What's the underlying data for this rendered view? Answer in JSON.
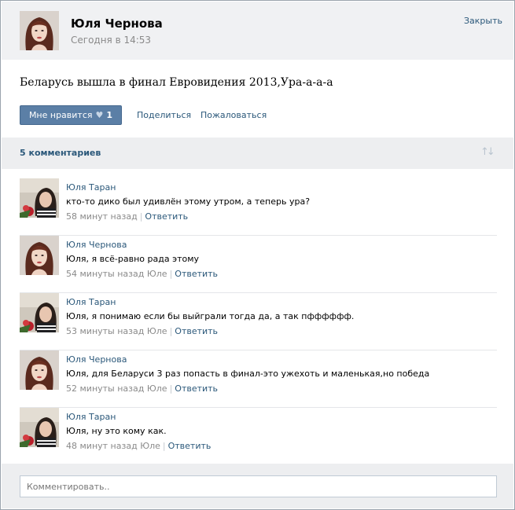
{
  "post": {
    "author": "Юля Чернова",
    "time": "Сегодня в 14:53",
    "close_label": "Закрыть",
    "text": "Беларусь вышла в финал Евровидения 2013,Ура-а-а-а",
    "like_label": "Мне нравится",
    "like_count": "1",
    "share_label": "Поделиться",
    "report_label": "Пожаловаться"
  },
  "comments_header": {
    "count_label": "5 комментариев",
    "sort_icon": "sort-arrows-icon"
  },
  "comments": [
    {
      "author": "Юля Таран",
      "avatar": "brunette",
      "text": "кто-то дико был удивлён этому утром, а теперь ура?",
      "time": "58 минут назад",
      "reply_to": "",
      "reply_label": "Ответить"
    },
    {
      "author": "Юля Чернова",
      "avatar": "redhead",
      "text": "Юля, я всё-равно рада этому",
      "time": "54 минуты назад",
      "reply_to": "Юле",
      "reply_label": "Ответить"
    },
    {
      "author": "Юля Таран",
      "avatar": "brunette",
      "text": "Юля, я понимаю если бы выйграли тогда да, а так пфффффф.",
      "time": "53 минуты назад",
      "reply_to": "Юле",
      "reply_label": "Ответить"
    },
    {
      "author": "Юля Чернова",
      "avatar": "redhead",
      "text": "Юля, для Беларуси 3 раз попасть в финал-это ужехоть и маленькая,но победа",
      "time": "52 минуты назад",
      "reply_to": "Юле",
      "reply_label": "Ответить"
    },
    {
      "author": "Юля Таран",
      "avatar": "brunette",
      "text": "Юля, ну это кому как.",
      "time": "48 минут назад",
      "reply_to": "Юле",
      "reply_label": "Ответить"
    }
  ],
  "composer": {
    "placeholder": "Комментировать.."
  },
  "colors": {
    "link": "#2b587a",
    "button": "#5b7fa6",
    "header_bg": "#f0f1f3"
  }
}
